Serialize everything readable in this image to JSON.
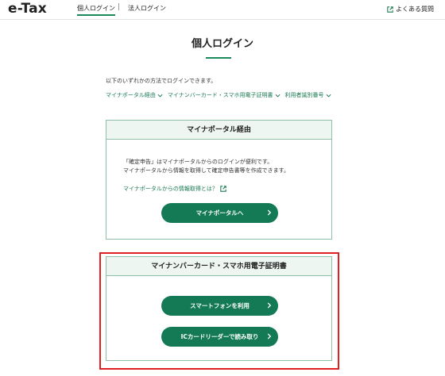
{
  "header": {
    "logo": "e-Tax",
    "tabs": [
      {
        "label": "個人ログイン",
        "active": true
      },
      {
        "label": "法人ログイン",
        "active": false
      }
    ],
    "separator": "|",
    "faq_label": "よくある質問"
  },
  "page": {
    "title": "個人ログイン",
    "intro": "以下のいずれかの方法でログインできます。",
    "anchors": [
      {
        "label": "マイナポータル経由"
      },
      {
        "label": "マイナンバーカード・スマホ用電子証明書"
      },
      {
        "label": "利用者識別番号"
      }
    ]
  },
  "mynaportal_card": {
    "title": "マイナポータル経由",
    "description_line1": "「確定申告」はマイナポータルからのログインが便利です。",
    "description_line2": "マイナポータルから情報を取得して確定申告書等を作成できます。",
    "info_link": "マイナポータルからの情報取得とは？",
    "button_label": "マイナポータルへ"
  },
  "mynumber_card": {
    "title": "マイナンバーカード・スマホ用電子証明書",
    "smartphone_button": "スマートフォンを利用",
    "icreader_button": "ICカードリーダーで読み取り"
  },
  "colors": {
    "accent": "#137a55",
    "link": "#1a7a52",
    "card_header_bg": "#eef6f2",
    "card_border": "#8fbfa6",
    "highlight": "#e02020"
  },
  "icons": [
    "external-link-icon",
    "chevron-down-icon",
    "chevron-right-icon"
  ]
}
